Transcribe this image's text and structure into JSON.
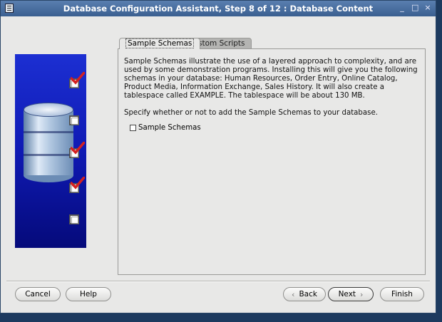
{
  "window": {
    "title": "Database Configuration Assistant, Step 8 of 12 : Database Content",
    "controls": {
      "minimize": "_",
      "maximize": "□",
      "close": "×"
    }
  },
  "steps": {
    "icons": [
      "checked",
      "unchecked",
      "checked",
      "checked",
      "unchecked"
    ],
    "check_color": "#d42020"
  },
  "tabs": [
    {
      "label": "Sample Schemas",
      "active": true
    },
    {
      "label": "Custom Scripts",
      "active": false
    }
  ],
  "content": {
    "description": "Sample Schemas illustrate the use of a layered approach to complexity, and are used by some demonstration programs. Installing this will give you the following schemas in your database: Human Resources, Order Entry, Online Catalog, Product Media, Information Exchange, Sales History. It will also create a tablespace called EXAMPLE. The tablespace will be about 130 MB.",
    "prompt": "Specify whether or not to add the Sample Schemas to your database.",
    "checkbox_label": "Sample Schemas",
    "checkbox_checked": false
  },
  "buttons": {
    "cancel": "Cancel",
    "help": "Help",
    "back": "Back",
    "next": "Next",
    "finish": "Finish"
  },
  "icons": {
    "back": "chevron-left-icon",
    "next": "chevron-right-icon"
  }
}
